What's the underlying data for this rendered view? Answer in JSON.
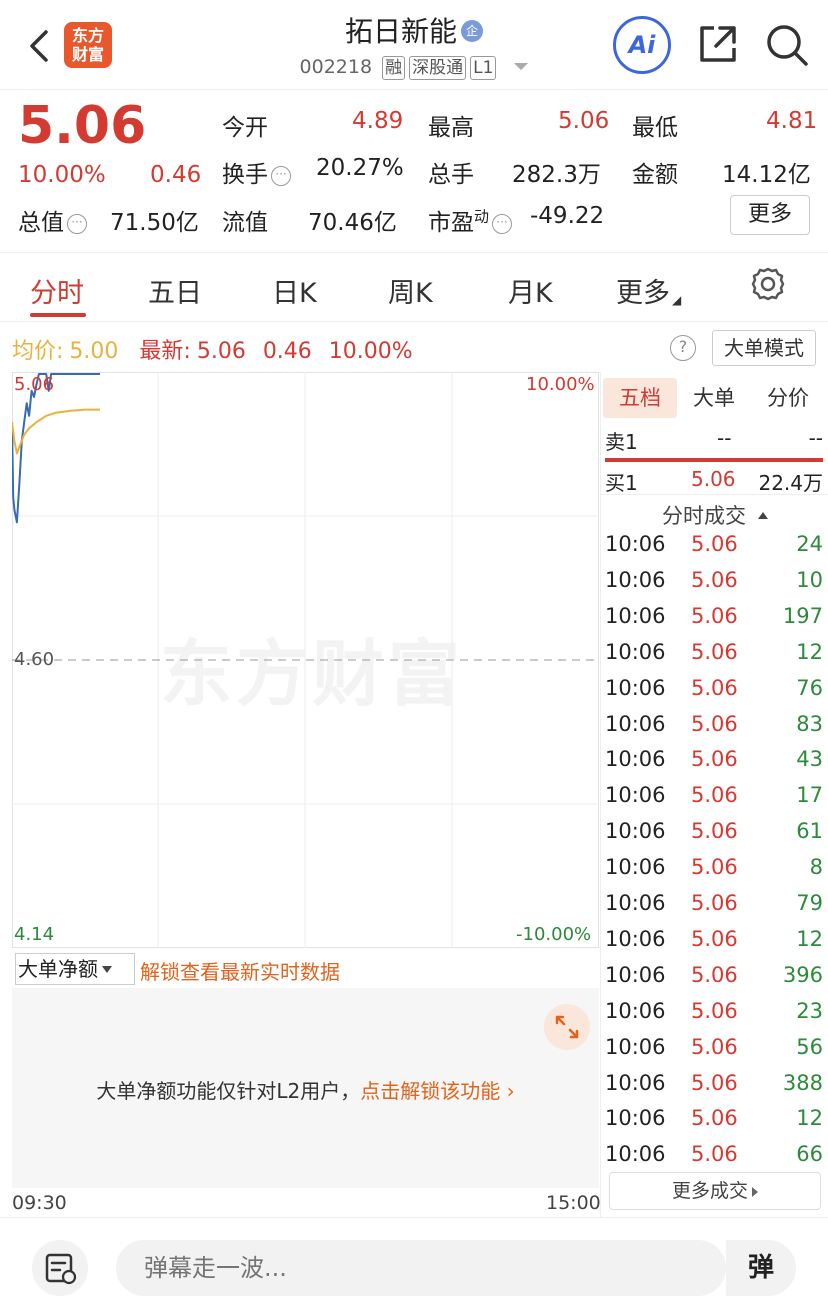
{
  "header": {
    "logo_text_line1": "东方",
    "logo_text_line2": "财富",
    "stock_name": "拓日新能",
    "badge": "企",
    "code": "002218",
    "tags": [
      "融",
      "深股通",
      "L1"
    ],
    "ai_label": "Ai"
  },
  "quote": {
    "price": "5.06",
    "change_pct": "10.00%",
    "change": "0.46",
    "open_label": "今开",
    "open": "4.89",
    "high_label": "最高",
    "high": "5.06",
    "low_label": "最低",
    "low": "4.81",
    "turnover_label": "换手",
    "turnover": "20.27%",
    "volume_label": "总手",
    "volume": "282.3万",
    "amount_label": "金额",
    "amount": "14.12亿",
    "mktcap_label": "总值",
    "mktcap": "71.50亿",
    "float_label": "流值",
    "float": "70.46亿",
    "pe_label": "市盈",
    "pe_sup": "动",
    "pe": "-49.22",
    "more_label": "更多"
  },
  "tabs": {
    "items": [
      "分时",
      "五日",
      "日K",
      "周K",
      "月K",
      "更多"
    ],
    "active": 0
  },
  "info": {
    "avg_label": "均价:",
    "avg": "5.00",
    "latest_label": "最新:",
    "latest": "5.06",
    "latest_change": "0.46",
    "latest_pct": "10.00%",
    "help": "?",
    "mode_label": "大单模式"
  },
  "chart_data": {
    "type": "line",
    "y_labels": {
      "top": "5.06",
      "mid": "4.60",
      "bottom": "4.14"
    },
    "pct_labels": {
      "top": "10.00%",
      "bottom": "-10.00%"
    },
    "ylim": [
      4.14,
      5.06
    ],
    "prev_close": 4.6,
    "x_start_label": "09:30",
    "x_end_label": "15:00",
    "watermark": "东方财富",
    "series": [
      {
        "key": "price",
        "color": "#3a6ab0",
        "points": [
          [
            0,
            4.98
          ],
          [
            0.5,
            4.86
          ],
          [
            1,
            4.84
          ],
          [
            2,
            4.82
          ],
          [
            3,
            4.88
          ],
          [
            4,
            4.95
          ],
          [
            5,
            4.98
          ],
          [
            6,
            5.01
          ],
          [
            7,
            4.99
          ],
          [
            8,
            5.03
          ],
          [
            9,
            5.02
          ],
          [
            10,
            5.04
          ],
          [
            11,
            5.06
          ],
          [
            14,
            5.06
          ],
          [
            15,
            5.03
          ],
          [
            16,
            5.06
          ],
          [
            22,
            5.06
          ],
          [
            26,
            5.06
          ],
          [
            28,
            5.06
          ],
          [
            36,
            5.06
          ]
        ]
      },
      {
        "key": "avg",
        "color": "#e8b23c",
        "points": [
          [
            0,
            4.98
          ],
          [
            1,
            4.95
          ],
          [
            2,
            4.93
          ],
          [
            3,
            4.94
          ],
          [
            5,
            4.96
          ],
          [
            7,
            4.97
          ],
          [
            10,
            4.98
          ],
          [
            14,
            4.99
          ],
          [
            18,
            4.995
          ],
          [
            24,
            4.998
          ],
          [
            30,
            5.0
          ],
          [
            36,
            5.0
          ]
        ]
      }
    ],
    "x_total_minutes": 240
  },
  "bottom_chart": {
    "selector_label": "大单净额",
    "unlock_link": "解锁查看最新实时数据",
    "lock_msg_prefix": "大单净额功能仅针对L2用户，",
    "lock_msg_link": "点击解锁该功能"
  },
  "right_panel": {
    "tabs": [
      "五档",
      "大单",
      "分价"
    ],
    "active_tab": 0,
    "sell1": {
      "label": "卖1",
      "price": "--",
      "vol": "--"
    },
    "buy1": {
      "label": "买1",
      "price": "5.06",
      "vol": "22.4万"
    },
    "trades_title": "分时成交",
    "trades": [
      {
        "t": "10:06",
        "p": "5.06",
        "v": "24"
      },
      {
        "t": "10:06",
        "p": "5.06",
        "v": "10"
      },
      {
        "t": "10:06",
        "p": "5.06",
        "v": "197"
      },
      {
        "t": "10:06",
        "p": "5.06",
        "v": "12"
      },
      {
        "t": "10:06",
        "p": "5.06",
        "v": "76"
      },
      {
        "t": "10:06",
        "p": "5.06",
        "v": "83"
      },
      {
        "t": "10:06",
        "p": "5.06",
        "v": "43"
      },
      {
        "t": "10:06",
        "p": "5.06",
        "v": "17"
      },
      {
        "t": "10:06",
        "p": "5.06",
        "v": "61"
      },
      {
        "t": "10:06",
        "p": "5.06",
        "v": "8"
      },
      {
        "t": "10:06",
        "p": "5.06",
        "v": "79"
      },
      {
        "t": "10:06",
        "p": "5.06",
        "v": "12"
      },
      {
        "t": "10:06",
        "p": "5.06",
        "v": "396"
      },
      {
        "t": "10:06",
        "p": "5.06",
        "v": "23"
      },
      {
        "t": "10:06",
        "p": "5.06",
        "v": "56"
      },
      {
        "t": "10:06",
        "p": "5.06",
        "v": "388"
      },
      {
        "t": "10:06",
        "p": "5.06",
        "v": "12"
      },
      {
        "t": "10:06",
        "p": "5.06",
        "v": "66"
      }
    ],
    "more_trades": "更多成交"
  },
  "bottom_bar": {
    "placeholder": "弹幕走一波...",
    "danmu_label": "弹"
  },
  "colors": {
    "up": "#d33a31",
    "down": "#2c8a3a",
    "accent": "#e1641e",
    "price_line": "#3a6ab0",
    "avg_line": "#e8b23c"
  }
}
